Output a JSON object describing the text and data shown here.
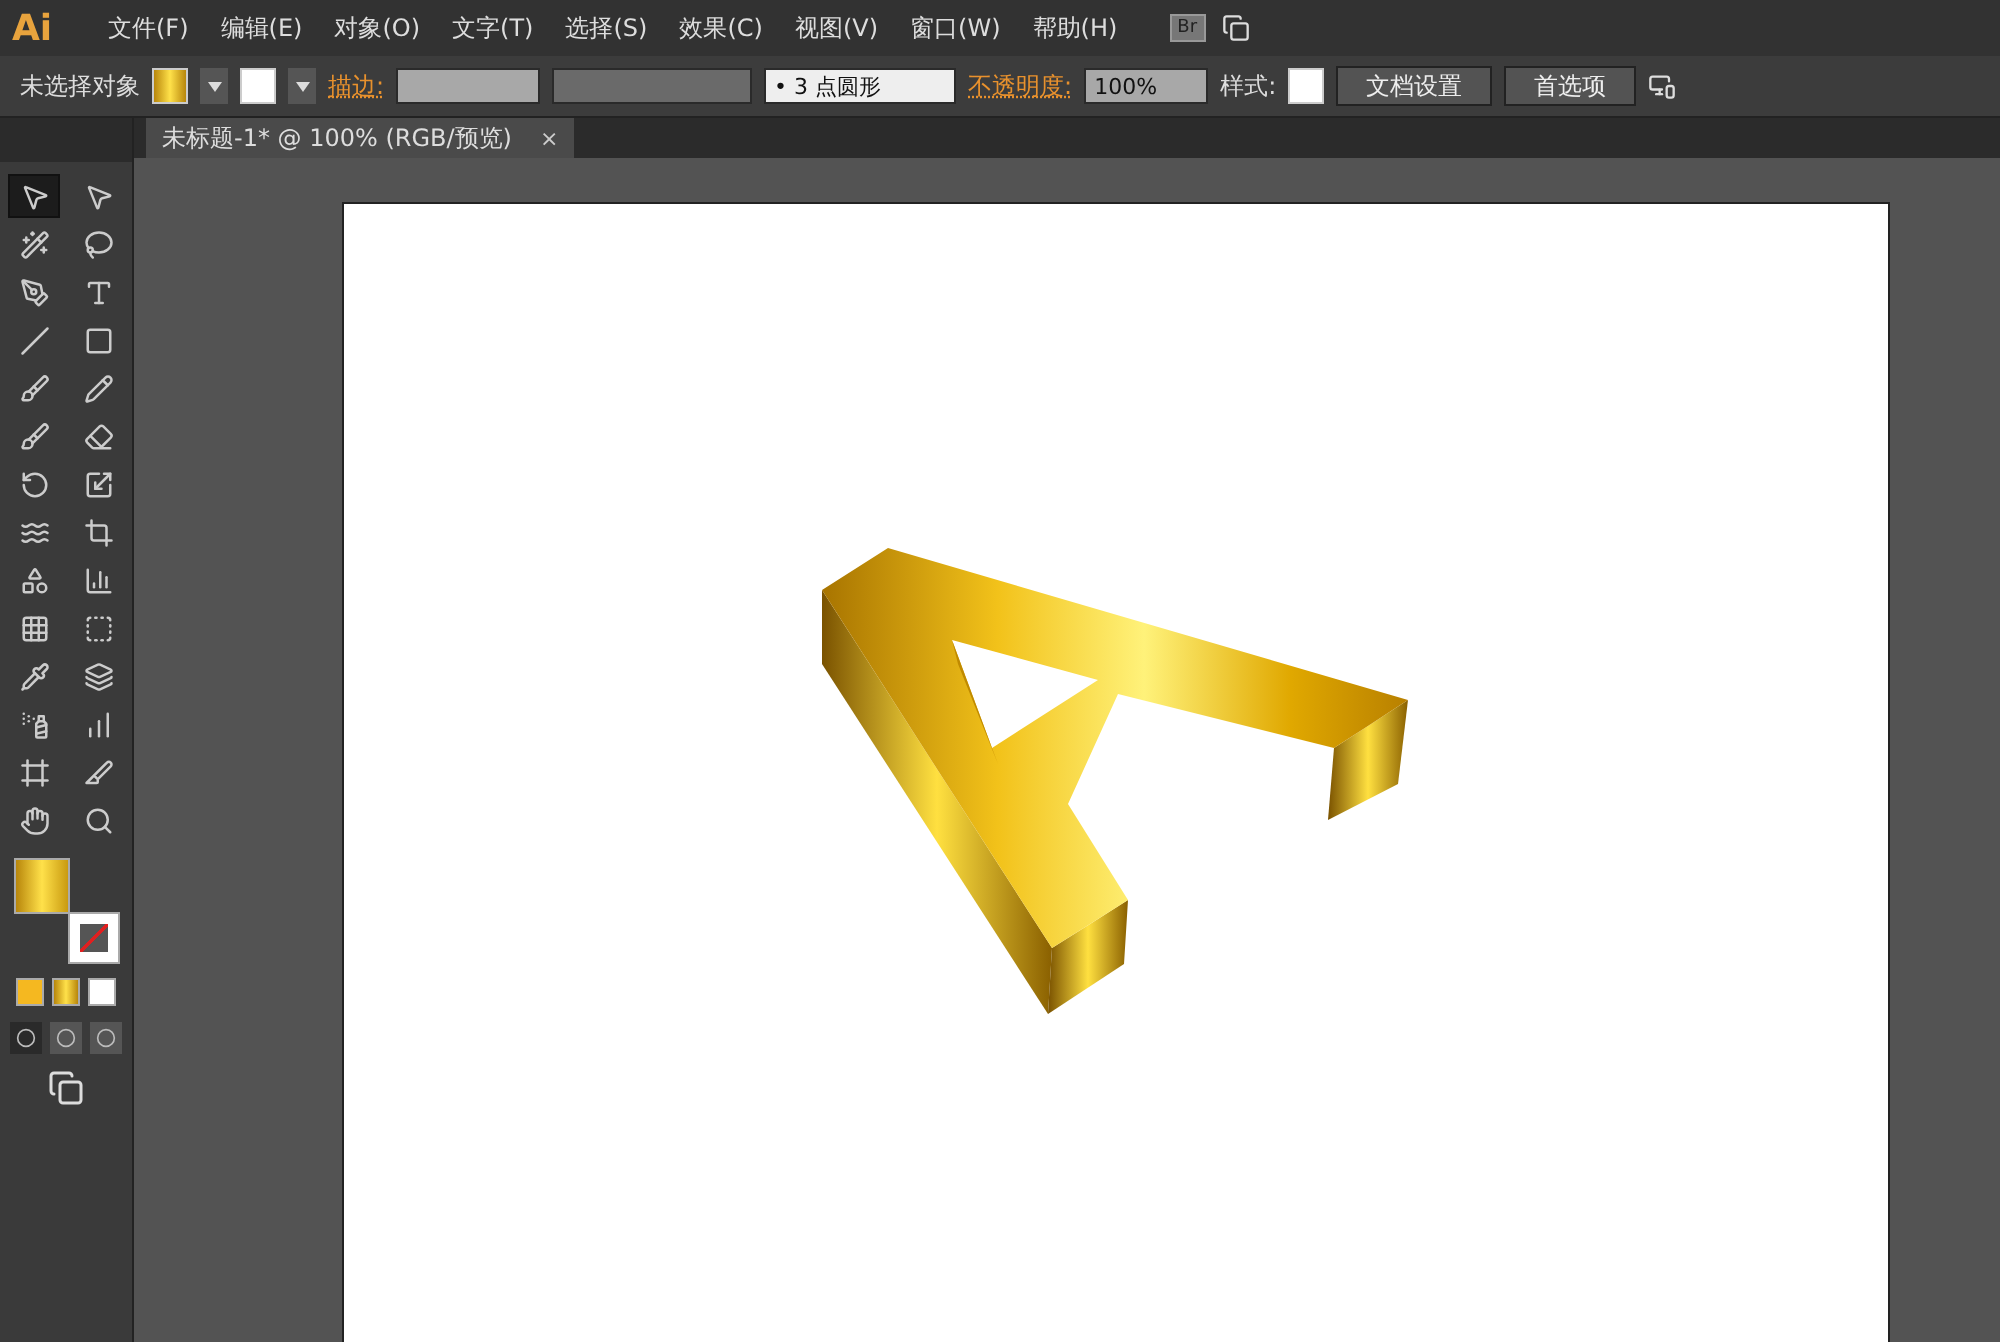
{
  "app": {
    "logo": "Ai"
  },
  "menu": [
    {
      "label": "文件(F)"
    },
    {
      "label": "编辑(E)"
    },
    {
      "label": "对象(O)"
    },
    {
      "label": "文字(T)"
    },
    {
      "label": "选择(S)"
    },
    {
      "label": "效果(C)"
    },
    {
      "label": "视图(V)"
    },
    {
      "label": "窗口(W)"
    },
    {
      "label": "帮助(H)"
    }
  ],
  "bridge_button": "Br",
  "control_bar": {
    "selection": "未选择对象",
    "stroke_label": "描边:",
    "brush": "• 3 点圆形",
    "opacity_label": "不透明度:",
    "opacity": "100%",
    "style_label": "样式:",
    "buttons": [
      "文档设置",
      "首选项"
    ]
  },
  "document_tab": {
    "title": "未标题-1* @ 100% (RGB/预览)",
    "close": "×"
  },
  "tools": [
    {
      "selected": true
    },
    {
      "selected": false
    },
    {
      "selected": false
    },
    {
      "selected": false
    },
    {
      "selected": false
    },
    {
      "selected": false
    },
    {
      "selected": false
    },
    {
      "selected": false
    },
    {
      "selected": false
    },
    {
      "selected": false
    },
    {
      "selected": false
    },
    {
      "selected": false
    },
    {
      "selected": false
    },
    {
      "selected": false
    },
    {
      "selected": false
    },
    {
      "selected": false
    },
    {
      "selected": false
    },
    {
      "selected": false
    },
    {
      "selected": false
    },
    {
      "selected": false
    },
    {
      "selected": false
    },
    {
      "selected": false
    },
    {
      "selected": false
    },
    {
      "selected": false
    },
    {
      "selected": false
    },
    {
      "selected": false
    },
    {
      "selected": false
    },
    {
      "selected": false
    }
  ],
  "draw_modes": [
    {
      "selected": true
    },
    {
      "selected": false
    },
    {
      "selected": false
    }
  ]
}
